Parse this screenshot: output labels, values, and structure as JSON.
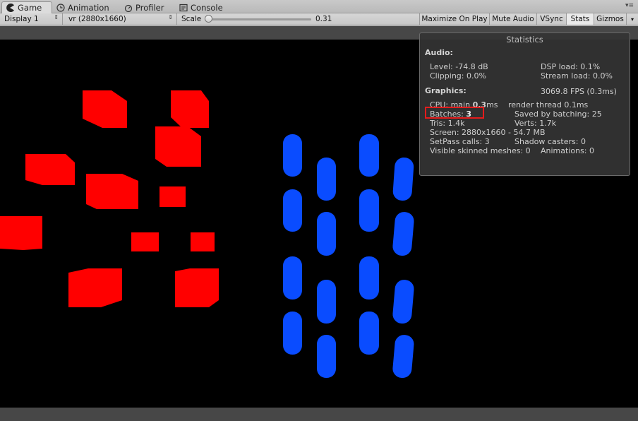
{
  "tabs": [
    {
      "label": "Game",
      "icon": "pacman-icon",
      "active": true
    },
    {
      "label": "Animation",
      "icon": "clock-icon",
      "active": false
    },
    {
      "label": "Profiler",
      "icon": "profiler-icon",
      "active": false
    },
    {
      "label": "Console",
      "icon": "console-icon",
      "active": false
    }
  ],
  "toolbar": {
    "display": "Display 1",
    "resolution": "vr (2880x1660)",
    "scale_label": "Scale",
    "scale_value": "0.31",
    "maximize_on_play": "Maximize On Play",
    "mute_audio": "Mute Audio",
    "vsync": "VSync",
    "stats": "Stats",
    "gizmos": "Gizmos"
  },
  "statistics": {
    "title": "Statistics",
    "audio_header": "Audio:",
    "level": "Level: -74.8 dB",
    "dsp_load": "DSP load: 0.1%",
    "clipping": "Clipping: 0.0%",
    "stream_load": "Stream load: 0.0%",
    "graphics_header": "Graphics:",
    "fps": "3069.8 FPS (0.3ms)",
    "cpu_prefix": "CPU: main ",
    "cpu_main_value": "0.3",
    "cpu_main_unit": "ms",
    "render_thread": "render thread 0.1ms",
    "batches_label": "Batches: ",
    "batches_value": "3",
    "saved_by_batching": "Saved by batching: 25",
    "tris": "Tris: 1.4k",
    "verts": "Verts: 1.7k",
    "screen": "Screen: 2880x1660 - 54.7 MB",
    "setpass_calls": "SetPass calls: 3",
    "shadow_casters": "Shadow casters: 0",
    "visible_skinned_meshes": "Visible skinned meshes: 0",
    "animations": "Animations: 0"
  },
  "colors": {
    "red_cubes": "#ff0000",
    "blue_cylinders": "#0a4cff",
    "highlight": "#e41c1c"
  }
}
